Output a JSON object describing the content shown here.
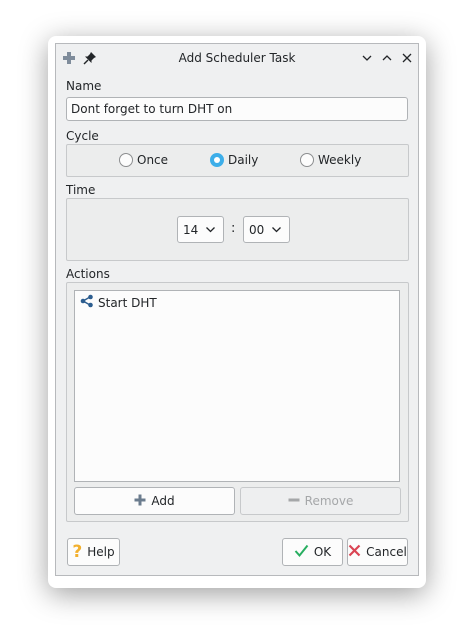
{
  "window": {
    "title": "Add Scheduler Task",
    "icons": [
      "app-icon",
      "pin-icon",
      "minimize-icon",
      "maximize-icon",
      "close-icon"
    ]
  },
  "name_section": {
    "label": "Name",
    "value": "Dont forget to turn DHT on"
  },
  "cycle_section": {
    "label": "Cycle",
    "options": [
      {
        "label": "Once",
        "checked": false
      },
      {
        "label": "Daily",
        "checked": true
      },
      {
        "label": "Weekly",
        "checked": false
      }
    ]
  },
  "time_section": {
    "label": "Time",
    "hour": "14",
    "separator": ":",
    "minute": "00"
  },
  "actions_section": {
    "label": "Actions",
    "items": [
      {
        "label": "Start DHT",
        "icon": "share-nodes-icon"
      }
    ],
    "add_label": "Add",
    "remove_label": "Remove"
  },
  "footer": {
    "help_label": "Help",
    "ok_label": "OK",
    "cancel_label": "Cancel"
  },
  "colors": {
    "accent": "#3daee9",
    "window_bg": "#eff0f1",
    "help_icon": "#f2b02e",
    "ok_icon": "#27ae60",
    "cancel_icon": "#da4453"
  }
}
